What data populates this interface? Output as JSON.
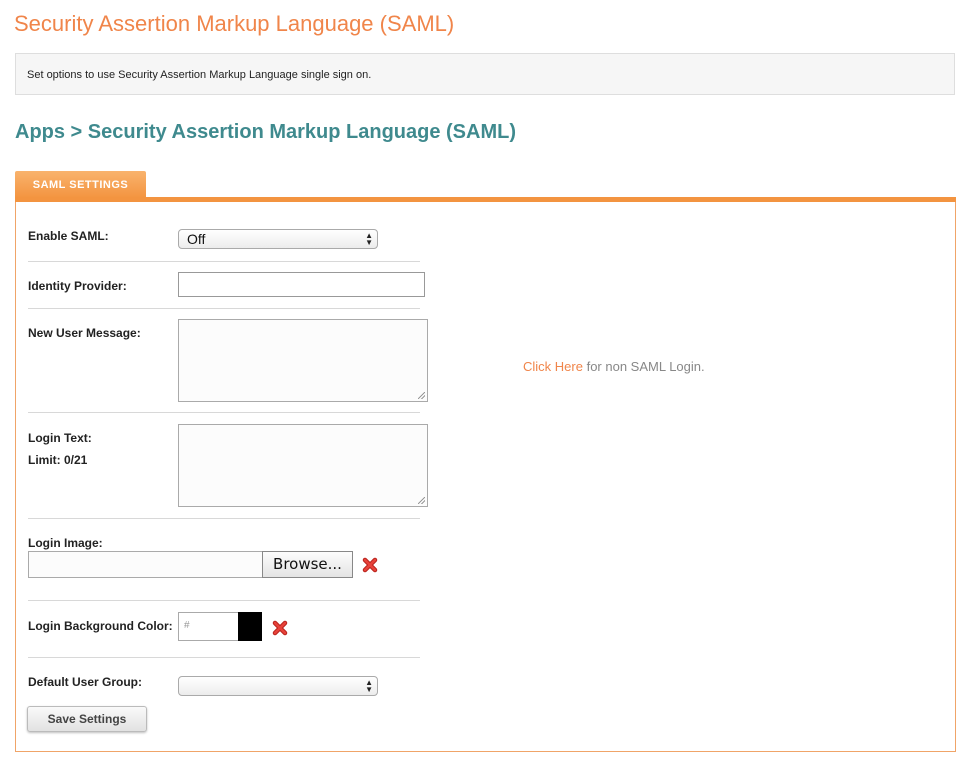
{
  "page": {
    "title": "Security Assertion Markup Language (SAML)",
    "description": "Set options to use Security Assertion Markup Language single sign on.",
    "breadcrumb": "Apps > Security Assertion Markup Language (SAML)"
  },
  "tabs": [
    {
      "label": "SAML SETTINGS",
      "active": true
    }
  ],
  "form": {
    "enable_saml": {
      "label": "Enable SAML:",
      "value": "Off"
    },
    "identity_provider": {
      "label": "Identity Provider:",
      "value": ""
    },
    "new_user_message": {
      "label": "New User Message:",
      "value": ""
    },
    "login_text": {
      "label": "Login Text:",
      "limit": "Limit: 0/21",
      "value": ""
    },
    "login_image": {
      "label": "Login Image:",
      "browse_label": "Browse...",
      "value": ""
    },
    "login_bg_color": {
      "label": "Login Background Color:",
      "placeholder": "#",
      "swatch_color": "#000000"
    },
    "default_user_group": {
      "label": "Default User Group:",
      "value": ""
    },
    "save_label": "Save Settings"
  },
  "non_saml": {
    "link_text": "Click Here",
    "suffix": " for non SAML Login."
  },
  "colors": {
    "accent": "#f0854a",
    "breadcrumb": "#3f8a8e",
    "delete": "#d9332b"
  },
  "icons": {
    "delete": "red-x-icon",
    "select_arrows": "up-down-arrows-icon"
  }
}
